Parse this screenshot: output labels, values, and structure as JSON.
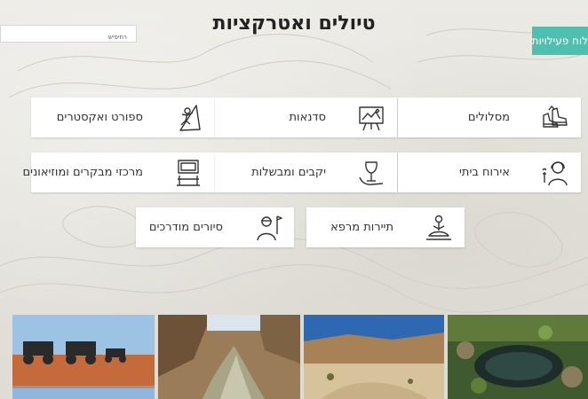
{
  "page": {
    "title": "טיולים ואטרקציות"
  },
  "search": {
    "value": "רחיפיש"
  },
  "activity_button": {
    "label": "לוח פעילויות"
  },
  "categories": [
    {
      "label": "מסלולים",
      "icon": "hiking-boots-icon"
    },
    {
      "label": "סדנאות",
      "icon": "easel-painting-icon"
    },
    {
      "label": "ספורט ואקסטרים",
      "icon": "climber-icon"
    },
    {
      "label": "אירוח ביתי",
      "icon": "host-woman-icon"
    },
    {
      "label": "יקבים ומבשלות",
      "icon": "wine-glass-icon"
    },
    {
      "label": "מרכזי מבקרים ומוזיאונים",
      "icon": "museum-frame-icon"
    },
    {
      "label": "תיירות מרפא",
      "icon": "meditation-icon"
    },
    {
      "label": "סיורים מודרכים",
      "icon": "tour-guide-icon"
    }
  ],
  "photos": [
    {
      "subject": "atv-desert-photo"
    },
    {
      "subject": "canyon-stream-photo"
    },
    {
      "subject": "desert-wadi-photo"
    },
    {
      "subject": "spring-pool-photo"
    }
  ],
  "colors": {
    "accent": "#4fc0b0",
    "background": "#e7e6e0",
    "card": "#ffffff"
  }
}
